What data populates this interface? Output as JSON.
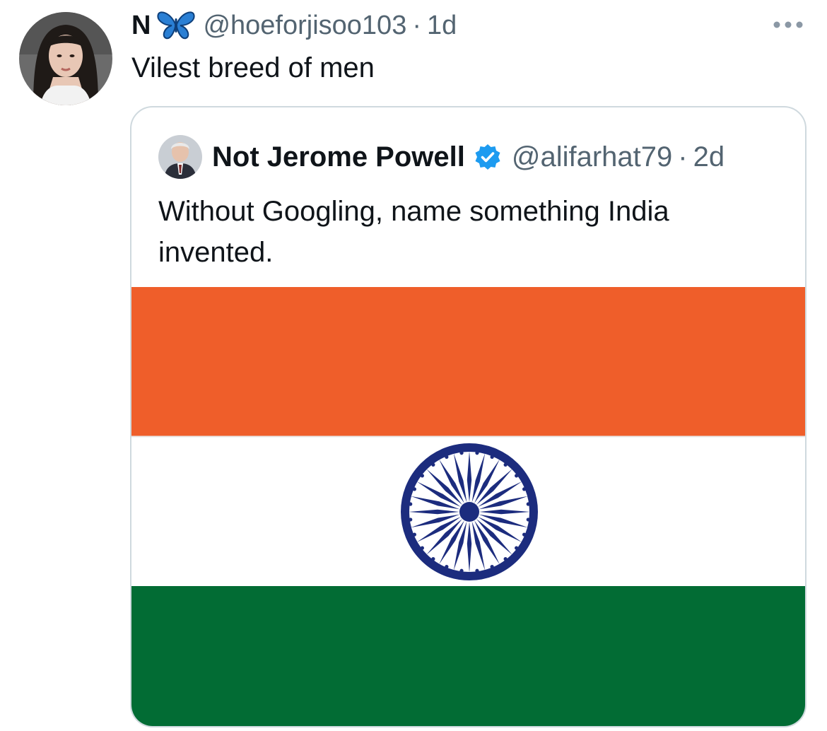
{
  "tweet": {
    "display_name": "N",
    "handle": "@hoeforjisoo103",
    "separator": "·",
    "time": "1d",
    "text": "Vilest breed of men",
    "avatar_icon": "user-avatar-photo",
    "name_emoji_icon": "butterfly-icon",
    "more_icon": "more-icon"
  },
  "quote": {
    "display_name": "Not Jerome Powell",
    "handle": "@alifarhat79",
    "separator": "·",
    "time": "2d",
    "text": "Without Googling, name something India invented.",
    "verified_icon": "verified-badge-icon",
    "media": {
      "type": "flag",
      "colors": {
        "saffron": "#ef5e2a",
        "white": "#ffffff",
        "green": "#026c34",
        "chakra": "#1c2c7e"
      }
    }
  },
  "colors": {
    "text_primary": "#0f1419",
    "text_secondary": "#536471",
    "border": "#cfd9de",
    "verified": "#1d9bf0"
  }
}
